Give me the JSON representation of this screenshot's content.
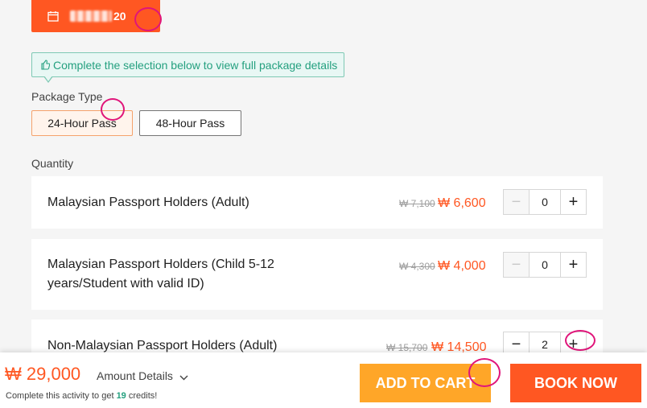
{
  "date_button": {
    "date_suffix": "20",
    "date_blurred": true
  },
  "tip": {
    "text": "Complete the selection below to view full package details"
  },
  "package_type": {
    "label": "Package Type",
    "options": [
      "24-Hour Pass",
      "48-Hour Pass"
    ],
    "selected": "24-Hour Pass"
  },
  "quantity": {
    "label": "Quantity",
    "items": [
      {
        "name": "Malaysian Passport Holders (Adult)",
        "old_price": "₩ 7,100",
        "price": "₩ 6,600",
        "qty": "0"
      },
      {
        "name_line1": "Malaysian Passport Holders (Child 5-12",
        "name_line2": "years/Student with valid ID)",
        "old_price": "₩ 4,300",
        "price": "₩ 4,000",
        "qty": "0"
      },
      {
        "name": "Non-Malaysian Passport Holders (Adult)",
        "old_price": "₩ 15,700",
        "price": "₩ 14,500",
        "qty": "2"
      }
    ],
    "minus_symbol": "−",
    "plus_symbol": "+"
  },
  "footer": {
    "total": "₩ 29,000",
    "amount_details": "Amount Details",
    "credits_prefix": "Complete this activity to get ",
    "credits_value": "19",
    "credits_suffix": " credits!",
    "add_to_cart": "ADD TO CART",
    "book_now": "BOOK NOW"
  },
  "colors": {
    "accent": "#ff5722",
    "cart": "#ffa628",
    "tip": "#24a07f",
    "annotation": "#e0157a"
  }
}
